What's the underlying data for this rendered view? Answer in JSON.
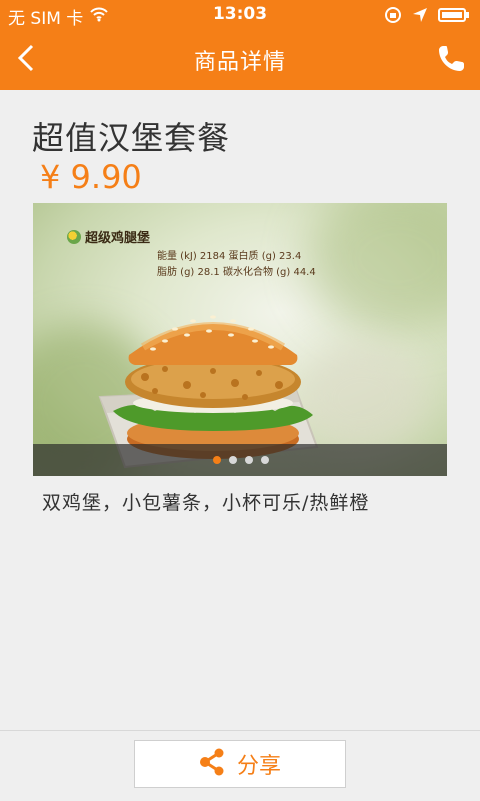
{
  "status_bar": {
    "carrier": "无 SIM 卡",
    "time": "13:03"
  },
  "navbar": {
    "title": "商品详情"
  },
  "product": {
    "name": "超值汉堡套餐",
    "price": "¥ 9.90",
    "description": "双鸡堡，小包薯条，小杯可乐/热鲜橙"
  },
  "banner": {
    "brand_label": "超级鸡腿堡",
    "nutrition_line1": "能量 (kJ) 2184  蛋白质 (g) 23.4",
    "nutrition_line2": "脂肪 (g) 28.1  碳水化合物 (g) 44.4",
    "slide_count": 4,
    "active_slide": 1
  },
  "footer": {
    "share_label": "分享"
  },
  "colors": {
    "accent": "#f57f17",
    "background": "#efefef"
  }
}
